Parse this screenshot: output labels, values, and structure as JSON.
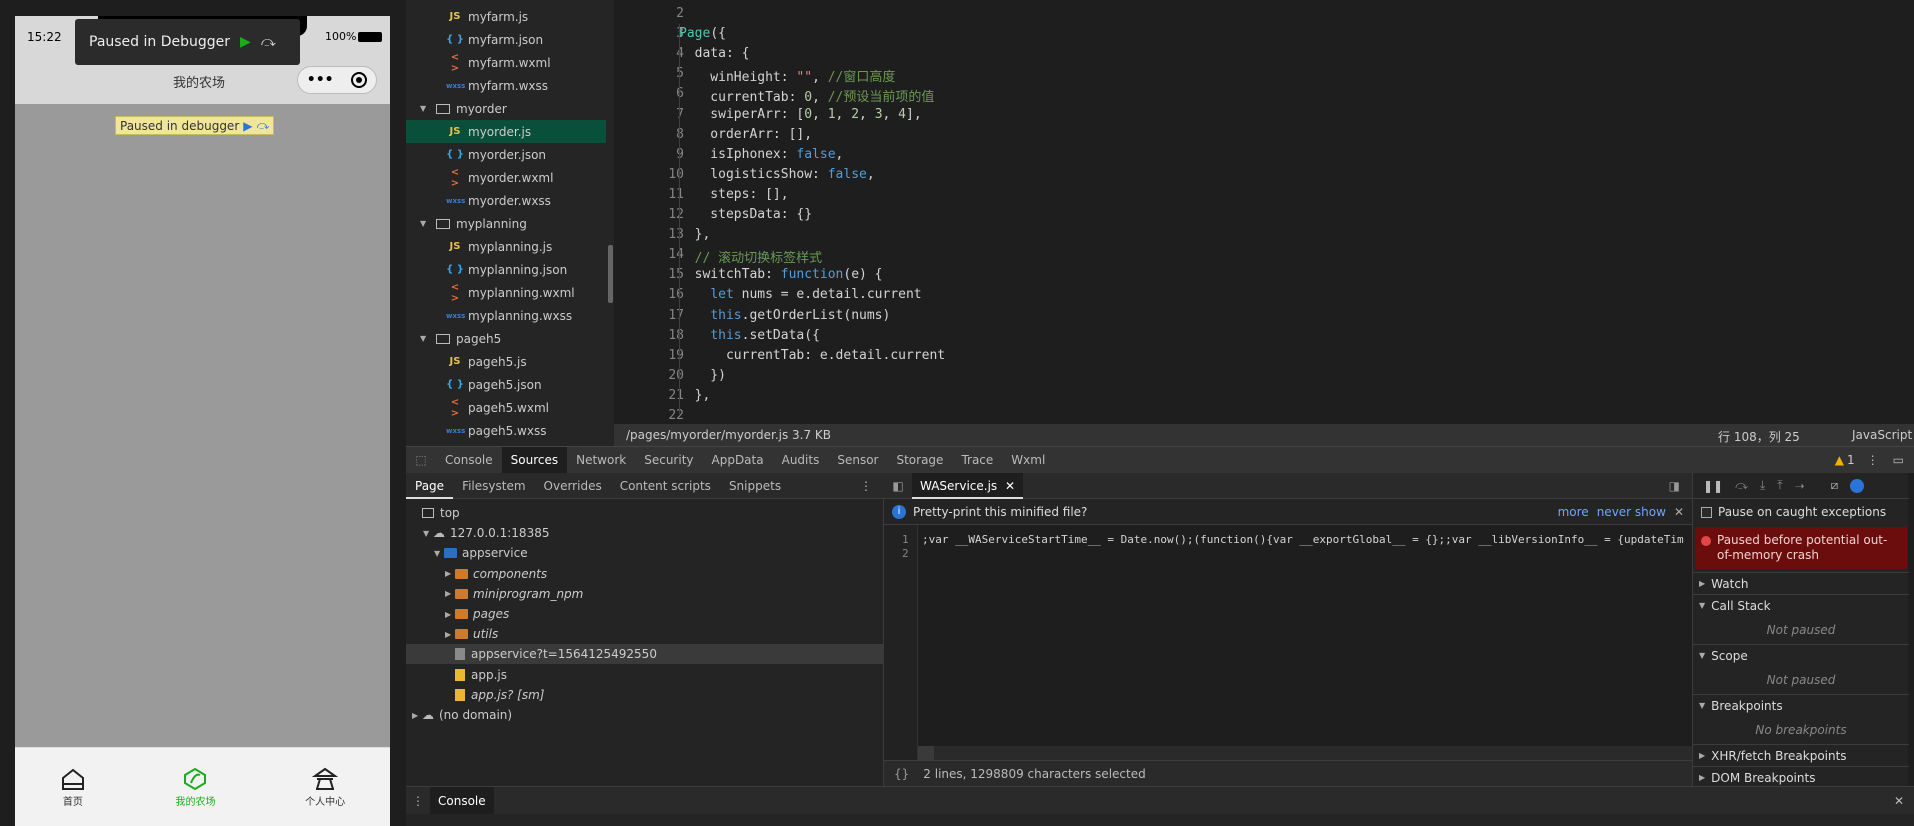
{
  "simulator": {
    "time": "15:22",
    "battery": "100%",
    "toast": "Paused in Debugger",
    "badge": "Paused in debugger",
    "nav_title": "我的农场",
    "tabs": [
      {
        "label": "首页",
        "active": false
      },
      {
        "label": "我的农场",
        "active": true
      },
      {
        "label": "个人中心",
        "active": false
      }
    ]
  },
  "filetree": {
    "rows": [
      {
        "kind": "js",
        "label": "myfarm.js"
      },
      {
        "kind": "json",
        "label": "myfarm.json"
      },
      {
        "kind": "wxml",
        "label": "myfarm.wxml"
      },
      {
        "kind": "wxss",
        "label": "myfarm.wxss"
      },
      {
        "kind": "folder",
        "label": "myorder"
      },
      {
        "kind": "js",
        "label": "myorder.js",
        "selected": true
      },
      {
        "kind": "json",
        "label": "myorder.json"
      },
      {
        "kind": "wxml",
        "label": "myorder.wxml"
      },
      {
        "kind": "wxss",
        "label": "myorder.wxss"
      },
      {
        "kind": "folder",
        "label": "myplanning"
      },
      {
        "kind": "js",
        "label": "myplanning.js"
      },
      {
        "kind": "json",
        "label": "myplanning.json"
      },
      {
        "kind": "wxml",
        "label": "myplanning.wxml"
      },
      {
        "kind": "wxss",
        "label": "myplanning.wxss"
      },
      {
        "kind": "folder",
        "label": "pageh5"
      },
      {
        "kind": "js",
        "label": "pageh5.js"
      },
      {
        "kind": "json",
        "label": "pageh5.json"
      },
      {
        "kind": "wxml",
        "label": "pageh5.wxml"
      },
      {
        "kind": "wxss",
        "label": "pageh5.wxss"
      }
    ],
    "icon_js": "JS",
    "icon_json": "{ }",
    "icon_wxml": "< >",
    "icon_wxss": "wxss"
  },
  "editor": {
    "lines": [
      {
        "n": "2",
        "html": ""
      },
      {
        "n": "3",
        "html": "<span class='k'>Page</span>({"
      },
      {
        "n": "4",
        "html": "  data: {"
      },
      {
        "n": "5",
        "html": "    winHeight: <span class='s'>\"\"</span>, <span class='c'>//窗口高度</span>"
      },
      {
        "n": "6",
        "html": "    currentTab: <span class='n'>0</span>, <span class='c'>//预设当前项的值</span>"
      },
      {
        "n": "7",
        "html": "    swiperArr: [<span class='n'>0</span>, <span class='n'>1</span>, <span class='n'>2</span>, <span class='n'>3</span>, <span class='n'>4</span>],"
      },
      {
        "n": "8",
        "html": "    orderArr: [],"
      },
      {
        "n": "9",
        "html": "    isIphonex: <span class='b'>false</span>,"
      },
      {
        "n": "10",
        "html": "    logisticsShow: <span class='b'>false</span>,"
      },
      {
        "n": "11",
        "html": "    steps: [],"
      },
      {
        "n": "12",
        "html": "    stepsData: {}"
      },
      {
        "n": "13",
        "html": "  },"
      },
      {
        "n": "14",
        "html": "  <span class='c'>// 滚动切换标签样式</span>"
      },
      {
        "n": "15",
        "html": "  switchTab: <span class='b'>function</span>(e) {"
      },
      {
        "n": "16",
        "html": "    <span class='b'>let</span> nums = e.detail.current"
      },
      {
        "n": "17",
        "html": "    <span class='b'>this</span>.getOrderList(nums)"
      },
      {
        "n": "18",
        "html": "    <span class='b'>this</span>.setData({"
      },
      {
        "n": "19",
        "html": "      currentTab: e.detail.current"
      },
      {
        "n": "20",
        "html": "    })"
      },
      {
        "n": "21",
        "html": "  },"
      },
      {
        "n": "22",
        "html": ""
      }
    ],
    "status": {
      "path": "/pages/myorder/myorder.js",
      "size": "3.7 KB",
      "position": "行 108，列 25",
      "language": "JavaScript"
    }
  },
  "devtools": {
    "tabs": [
      "Console",
      "Sources",
      "Network",
      "Security",
      "AppData",
      "Audits",
      "Sensor",
      "Storage",
      "Trace",
      "Wxml"
    ],
    "active_tab": "Sources",
    "warnings": "1",
    "source_tabs": [
      "Page",
      "Filesystem",
      "Overrides",
      "Content scripts",
      "Snippets"
    ],
    "navigator": [
      {
        "depth": 0,
        "arrow": "",
        "icon": "frame",
        "label": "top"
      },
      {
        "depth": 1,
        "arrow": "▼",
        "icon": "cloud",
        "label": "127.0.0.1:18385"
      },
      {
        "depth": 2,
        "arrow": "▼",
        "icon": "bfolder",
        "label": "appservice"
      },
      {
        "depth": 3,
        "arrow": "▶",
        "icon": "folder",
        "label": "components",
        "italic": true
      },
      {
        "depth": 3,
        "arrow": "▶",
        "icon": "folder",
        "label": "miniprogram_npm",
        "italic": true
      },
      {
        "depth": 3,
        "arrow": "▶",
        "icon": "folder",
        "label": "pages",
        "italic": true
      },
      {
        "depth": 3,
        "arrow": "▶",
        "icon": "folder",
        "label": "utils",
        "italic": true
      },
      {
        "depth": 3,
        "arrow": "",
        "icon": "gfile",
        "label": "appservice?t=1564125492550",
        "selected": true
      },
      {
        "depth": 3,
        "arrow": "",
        "icon": "file",
        "label": "app.js"
      },
      {
        "depth": 3,
        "arrow": "",
        "icon": "file",
        "label": "app.js? [sm]",
        "italic": true
      },
      {
        "depth": 0,
        "arrow": "▶",
        "icon": "cloud",
        "label": "(no domain)"
      }
    ],
    "file_tab": "WAService.js",
    "pretty_print": "Pretty-print this minified file?",
    "pp_more": "more",
    "pp_never": "never show",
    "code_line1": ";var __WAServiceStartTime__ = Date.now();(function(){var __exportGlobal__ = {};;var __libVersionInfo__ = {updateTim",
    "code_status": "2 lines, 1298809 characters selected",
    "pause_caught": "Pause on caught exceptions",
    "paused_msg": "Paused before potential out-of-memory crash",
    "sections": [
      {
        "label": "Watch"
      },
      {
        "label": "Call Stack",
        "sub": "Not paused"
      },
      {
        "label": "Scope",
        "sub": "Not paused"
      },
      {
        "label": "Breakpoints",
        "sub": "No breakpoints"
      },
      {
        "label": "XHR/fetch Breakpoints"
      },
      {
        "label": "DOM Breakpoints"
      }
    ],
    "drawer_tab": "Console"
  },
  "colors": {
    "selected_file": "#094f3a",
    "pause_banner": "#6b0d0d",
    "accent_green": "#1aad19"
  }
}
